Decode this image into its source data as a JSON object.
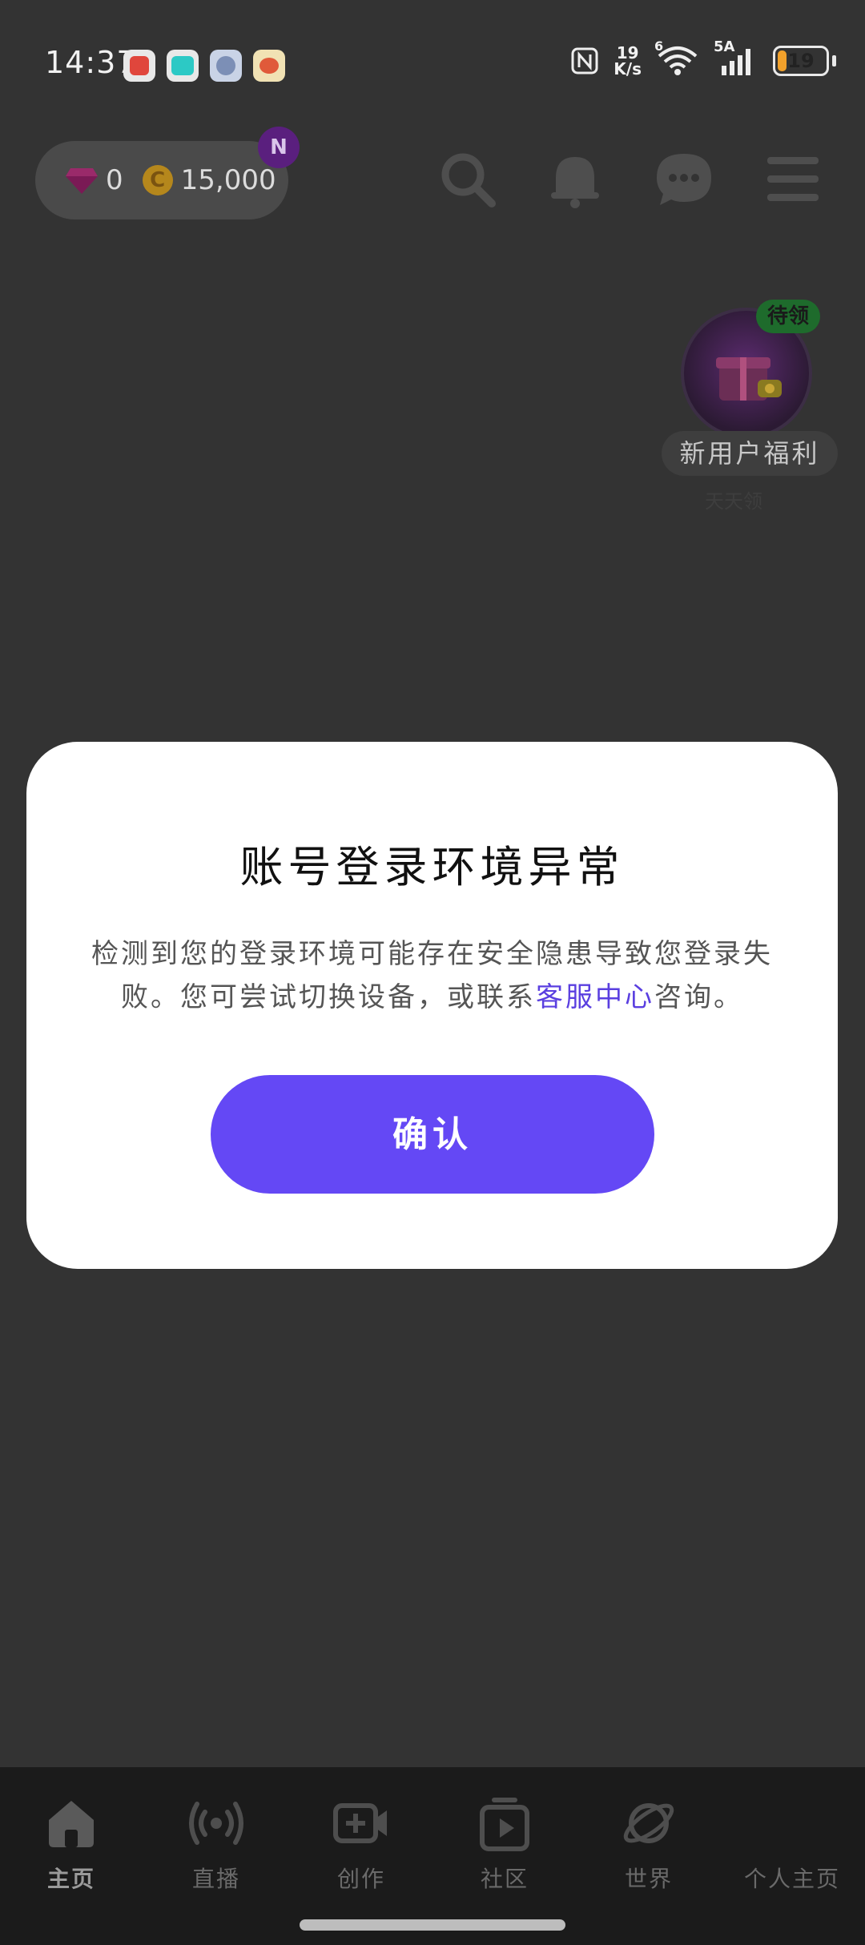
{
  "status_bar": {
    "time": "14:37",
    "net_speed_value": "19",
    "net_speed_unit": "K/s",
    "wifi_label": "6",
    "signal_label": "5A",
    "battery": "19",
    "battery_level": 0.19,
    "notification_icons": [
      "video-app-icon",
      "taptap-app-icon",
      "game-app-icon",
      "weibo-app-icon"
    ]
  },
  "header": {
    "gems": "0",
    "coins": "15,000",
    "coin_symbol": "C",
    "badge": "N"
  },
  "welfare": {
    "tag": "待领",
    "label": "新用户福利",
    "sub": "天天领"
  },
  "dialog": {
    "title": "账号登录环境异常",
    "body_prefix": "检测到您的登录环境可能存在安全隐患导致您登录失败。您可尝试切换设备，或联系",
    "link": "客服中心",
    "body_suffix": "咨询。",
    "confirm": "确认"
  },
  "nav": {
    "items": [
      {
        "label": "主页",
        "icon": "home-icon"
      },
      {
        "label": "直播",
        "icon": "broadcast-icon"
      },
      {
        "label": "创作",
        "icon": "video-add-icon"
      },
      {
        "label": "社区",
        "icon": "community-icon"
      },
      {
        "label": "世界",
        "icon": "planet-icon"
      },
      {
        "label": "个人主页",
        "icon": "profile-icon"
      }
    ]
  },
  "colors": {
    "accent": "#6448f5",
    "link": "#5a3fe0",
    "overlay_bg": "#333333"
  }
}
